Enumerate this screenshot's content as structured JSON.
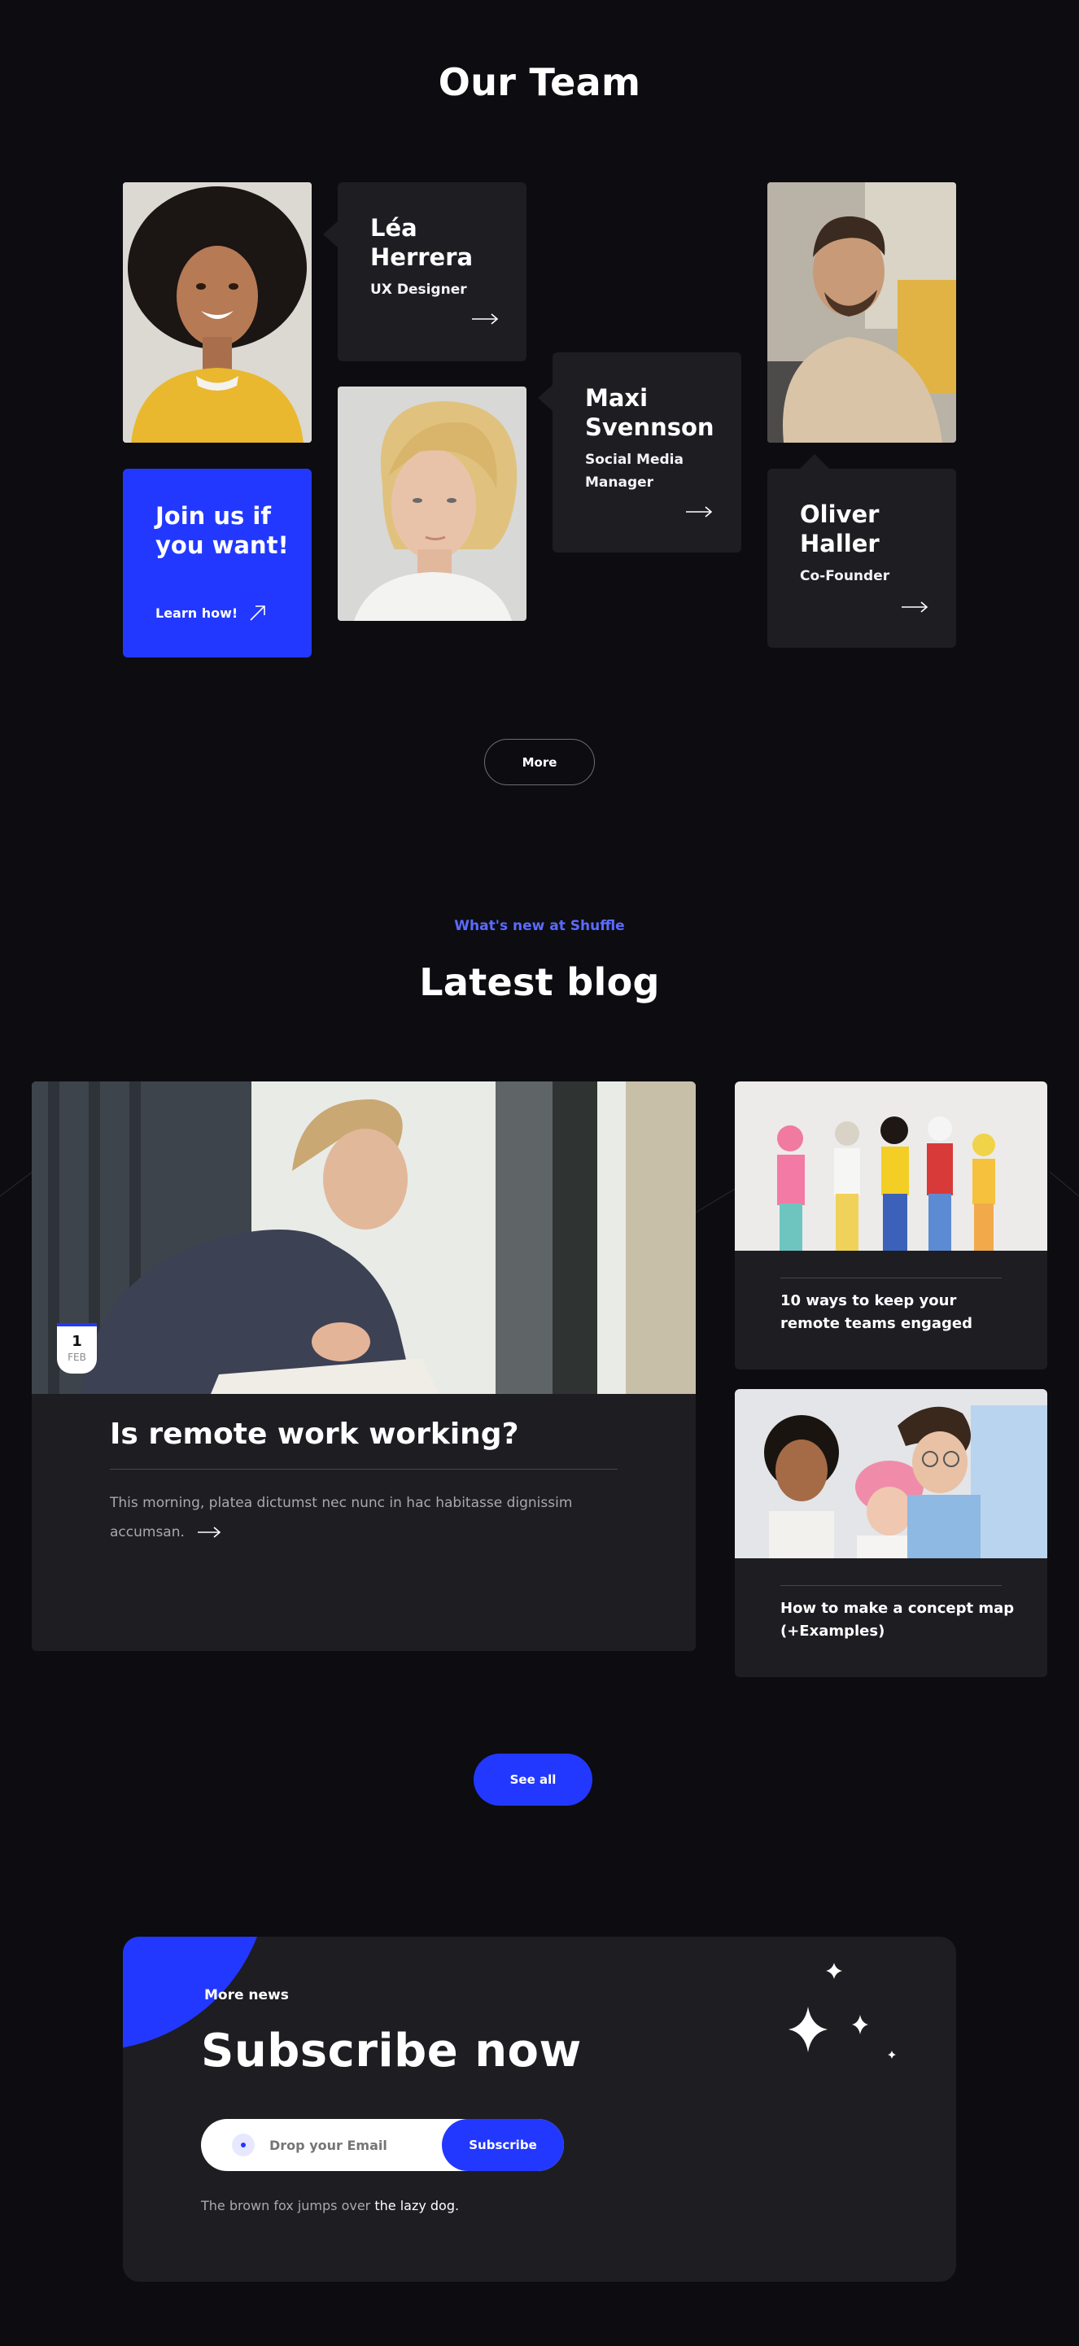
{
  "team": {
    "title": "Our Team",
    "members": [
      {
        "name": "Léa Herrera",
        "role": "UX Designer"
      },
      {
        "name": "Maxi Svennson",
        "role": "Social Media Manager"
      },
      {
        "name": "Oliver Haller",
        "role": "Co-Founder"
      }
    ],
    "join": {
      "title": "Join us if you want!",
      "link_label": "Learn how!"
    },
    "more_label": "More"
  },
  "blog": {
    "eyebrow": "What's new at Shuffle",
    "title": "Latest blog",
    "featured": {
      "date_day": "1",
      "date_month": "FEB",
      "title": "Is remote work working?",
      "excerpt": "This morning, platea dictumst nec nunc in hac habitasse dignissim accumsan."
    },
    "posts": [
      {
        "title": "10 ways to keep your remote teams engaged"
      },
      {
        "title": "How to make a concept map (+Examples)"
      }
    ],
    "see_all_label": "See all"
  },
  "subscribe": {
    "eyebrow": "More news",
    "title": "Subscribe now",
    "email_placeholder": "Drop your Email",
    "button_label": "Subscribe",
    "note_prefix": "The brown fox jumps over",
    "note_highlight": "the lazy dog."
  },
  "colors": {
    "background": "#0d0c11",
    "card": "#1e1d22",
    "accent": "#2238ff",
    "eyebrow": "#5a6bff"
  },
  "icons": [
    "arrow-right-icon",
    "arrow-up-right-icon",
    "mail-dot-icon",
    "sparkle-icon"
  ]
}
